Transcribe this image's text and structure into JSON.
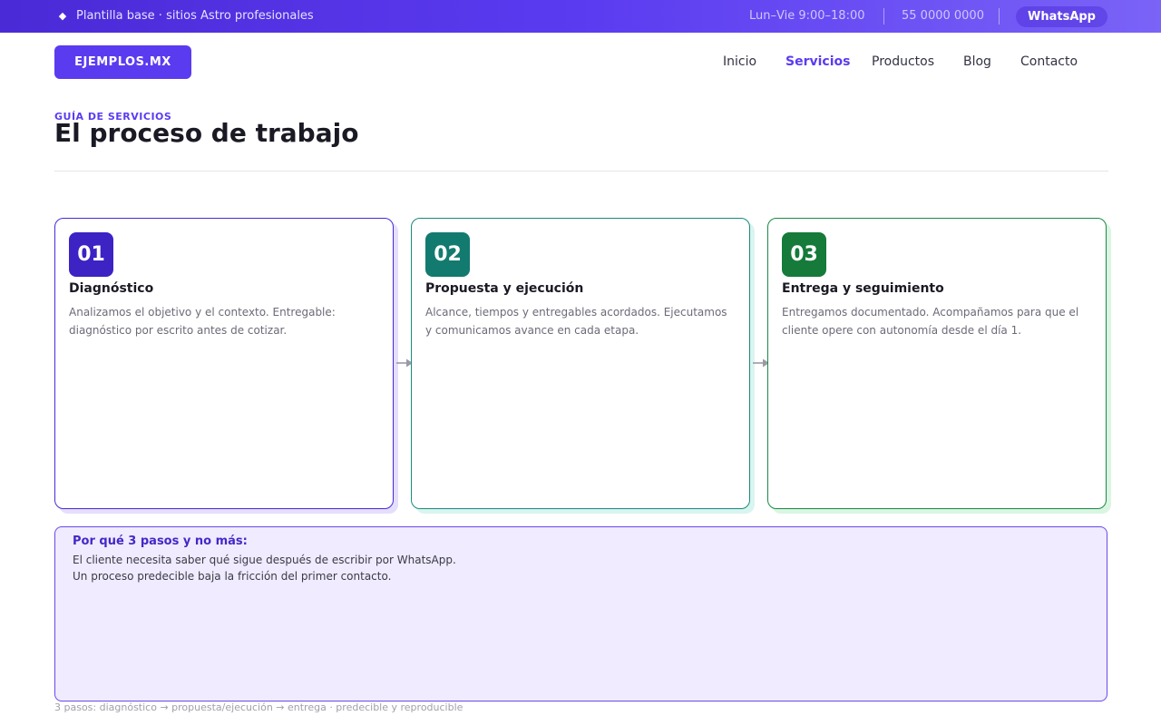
{
  "topbar": {
    "tagline": "Plantilla base · sitios Astro profesionales",
    "hours": "Lun–Vie  9:00–18:00",
    "phone": "55 0000 0000",
    "whatsapp": "WhatsApp"
  },
  "header": {
    "logo": "EJEMPLOS.MX",
    "nav": [
      "Inicio",
      "Servicios",
      "Productos",
      "Blog",
      "Contacto"
    ],
    "active": "Servicios"
  },
  "page": {
    "eyebrow": "GUÍA DE SERVICIOS",
    "title": "El proceso de trabajo"
  },
  "steps": [
    {
      "num": "01",
      "title": "Diagnóstico",
      "desc": "Analizamos el objetivo y el contexto. Entregable: diagnóstico por escrito antes de cotizar.",
      "color": "#3d22c4"
    },
    {
      "num": "02",
      "title": "Propuesta y ejecución",
      "desc": "Alcance, tiempos y entregables acordados. Ejecutamos y comunicamos avance en cada etapa.",
      "color": "#137a70"
    },
    {
      "num": "03",
      "title": "Entrega y seguimiento",
      "desc": "Entregamos documentado. Acompañamos para que el cliente opere con autonomía desde el día 1.",
      "color": "#157a3a"
    }
  ],
  "note": {
    "title": "Por qué 3 pasos y no más:",
    "line1": "El cliente necesita saber qué sigue después de escribir por WhatsApp.",
    "line2": "Un proceso predecible baja la fricción del primer contacto."
  },
  "footer": "3 pasos: diagnóstico → propuesta/ejecución → entrega · predecible y reproducible",
  "colors": {
    "accent": "#5b3bf0"
  }
}
